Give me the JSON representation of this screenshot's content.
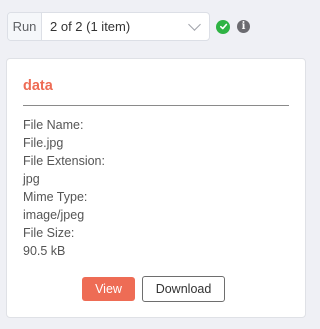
{
  "run_selector": {
    "label": "Run",
    "value": "2 of 2 (1 item)"
  },
  "status": {
    "success_icon": "check-circle-icon",
    "success_color": "#2fb344",
    "info_icon": "info-circle-icon",
    "info_glyph": "i"
  },
  "binary_card": {
    "title": "data",
    "accent_color": "#ee6c55",
    "properties": [
      {
        "label": "File Name:",
        "value": "File.jpg"
      },
      {
        "label": "File Extension:",
        "value": "jpg"
      },
      {
        "label": "Mime Type:",
        "value": "image/jpeg"
      },
      {
        "label": "File Size:",
        "value": "90.5 kB"
      }
    ],
    "view_label": "View",
    "download_label": "Download"
  }
}
